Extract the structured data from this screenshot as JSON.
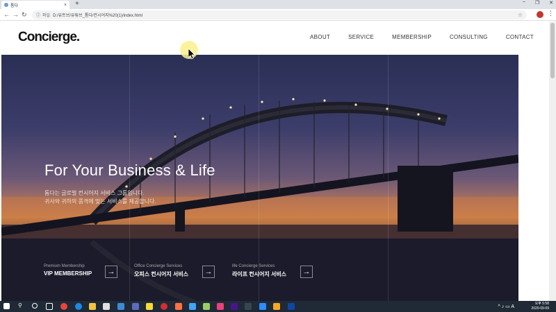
{
  "browser": {
    "tab_title": "톰다",
    "tab_close": "×",
    "new_tab": "+",
    "window_controls": [
      "−",
      "❐",
      "✕"
    ],
    "file_label": "파일",
    "url": "D:/유트브/유튜브_톰다/컨시어지%20(1)/index.html"
  },
  "site": {
    "logo": "Concierge.",
    "nav": [
      "ABOUT",
      "SERVICE",
      "MEMBERSHIP",
      "CONSULTING",
      "CONTACT"
    ]
  },
  "hero": {
    "title": "For Your Business & Life",
    "subtitle_line1": "톰다는 글로벌 컨시어지 서비스 그룹입니다.",
    "subtitle_line2": "귀사와 귀하의 품격에 맞는 서비스를 제공합니다.",
    "services": [
      {
        "caption": "Premium Membership",
        "name": "VIP MEMBERSHIP"
      },
      {
        "caption": "Office Concierge Services",
        "name": "오피스 컨시어지 서비스"
      },
      {
        "caption": "life Concierge Services",
        "name": "라이프 컨시어지 서비스"
      }
    ]
  },
  "taskbar": {
    "time": "오후 5:58",
    "date": "2020-09-09",
    "ime": "A"
  },
  "colors": {
    "accent": "#f0e68c",
    "hero_sky": "#3c3d6a",
    "hero_sunset": "#d08448"
  }
}
